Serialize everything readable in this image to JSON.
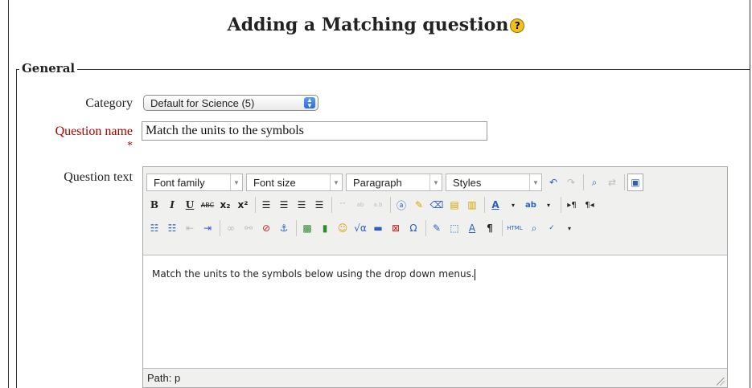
{
  "page": {
    "title": "Adding a Matching question",
    "help_icon": "?"
  },
  "fieldset": {
    "legend": "General"
  },
  "form": {
    "category_label": "Category",
    "category_value": "Default for Science (5)",
    "question_name_label": "Question name",
    "question_name_required": "*",
    "question_name_value": "Match the units to the symbols",
    "question_text_label": "Question text"
  },
  "editor": {
    "toolbar": {
      "font_family": "Font family",
      "font_size": "Font size",
      "format": "Paragraph",
      "styles": "Styles"
    },
    "content": "Match the units to the symbols below using the drop down menus.",
    "path_label": "Path: p"
  },
  "colors": {
    "required_label": "#a80000",
    "help_icon": "#f2c21b"
  },
  "icons": [
    "help-icon",
    "undo-icon",
    "redo-icon",
    "find-icon",
    "replace-icon",
    "fullscreen-icon",
    "bold-icon",
    "italic-icon",
    "underline-icon",
    "strikethrough-icon",
    "subscript-icon",
    "superscript-icon",
    "align-left-icon",
    "align-center-icon",
    "align-right-icon",
    "justify-icon",
    "cite-icon",
    "abbr-icon",
    "acronym-icon",
    "paste-text-icon",
    "cleanup-icon",
    "remove-format-icon",
    "paste-word-icon",
    "text-color-icon",
    "highlight-icon",
    "ltr-icon",
    "rtl-icon",
    "bullet-list-icon",
    "numbered-list-icon",
    "outdent-icon",
    "indent-icon",
    "link-icon",
    "unlink-icon",
    "nolink-icon",
    "anchor-icon",
    "image-icon",
    "media-icon",
    "emoticon-icon",
    "equation-icon",
    "hr-icon",
    "special-char-icon",
    "omega-icon",
    "edit-icon",
    "visual-aid-icon",
    "styleprops-icon",
    "paragraph-mark-icon",
    "html-icon",
    "search-icon",
    "spellcheck-icon"
  ]
}
